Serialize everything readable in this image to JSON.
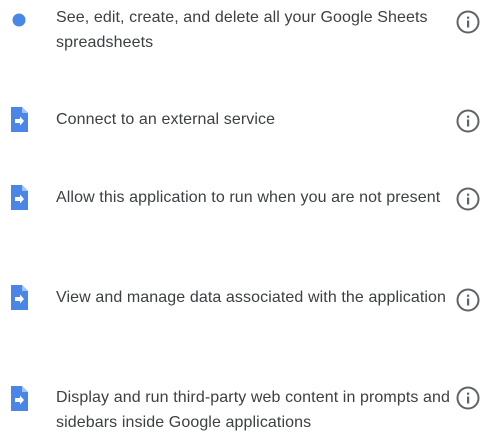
{
  "colors": {
    "dot": "#4a86e8",
    "script_icon": "#4a86e8",
    "text": "#3c4043",
    "info_icon": "#5f6368"
  },
  "permissions": [
    {
      "icon": "blue-dot-icon",
      "text": "See, edit, create, and delete all your Google Sheets spreadsheets"
    },
    {
      "icon": "apps-script-icon",
      "text": "Connect to an external service"
    },
    {
      "icon": "apps-script-icon",
      "text": "Allow this application to run when you are not present"
    },
    {
      "icon": "apps-script-icon",
      "text": "View and manage data associated with the application"
    },
    {
      "icon": "apps-script-icon",
      "text": "Display and run third-party web content in prompts and sidebars inside Google applications"
    }
  ]
}
